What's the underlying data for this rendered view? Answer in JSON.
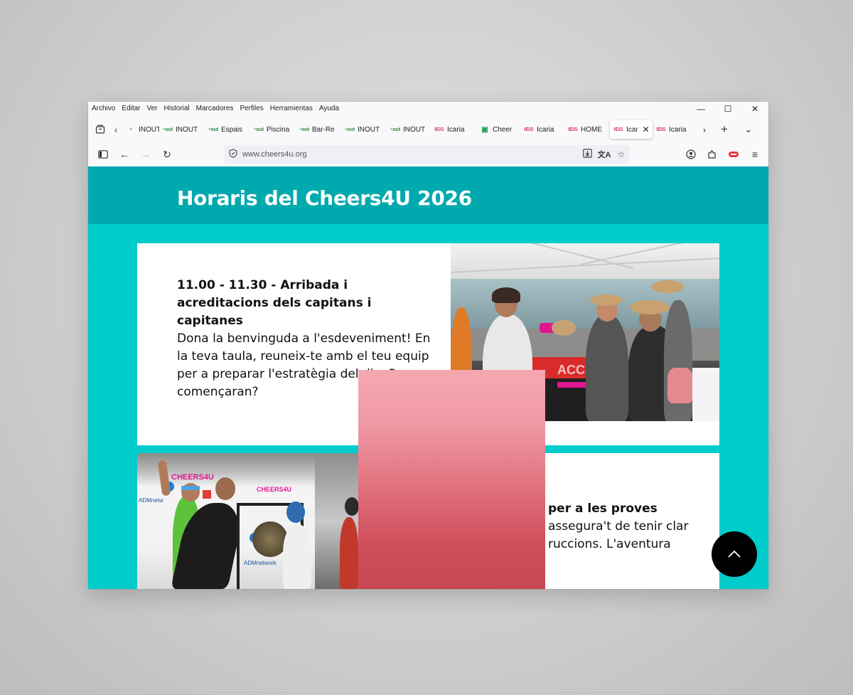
{
  "menubar": {
    "items": [
      "Archivo",
      "Editar",
      "Ver",
      "Historial",
      "Marcadores",
      "Perfiles",
      "Herramientas",
      "Ayuda"
    ]
  },
  "window_controls": {
    "minimize": "—",
    "maximize": "☐",
    "close": "✕"
  },
  "tabs": [
    {
      "label": "INOUT",
      "favicon": "inout"
    },
    {
      "label": "INOUT",
      "favicon": "inout"
    },
    {
      "label": "Espais",
      "favicon": "inout"
    },
    {
      "label": "Piscina",
      "favicon": "inout"
    },
    {
      "label": "Bar-Re",
      "favicon": "inout"
    },
    {
      "label": "INOUT",
      "favicon": "inout"
    },
    {
      "label": "INOUT",
      "favicon": "inout"
    },
    {
      "label": "Icaria",
      "favicon": "icaria"
    },
    {
      "label": "Cheer",
      "favicon": "cheer"
    },
    {
      "label": "Icaria",
      "favicon": "icaria"
    },
    {
      "label": "HOME",
      "favicon": "icaria"
    },
    {
      "label": "Icar",
      "favicon": "icaria",
      "active": true
    },
    {
      "label": "Icaria",
      "favicon": "icaria"
    }
  ],
  "navbar": {
    "url": "www.cheers4u.org"
  },
  "page": {
    "title": "Horaris del Cheers4U 2026",
    "card1": {
      "title": "11.00 - 11.30 - Arribada i acreditacions dels capitans i capitanes",
      "description": "Dona la benvinguda a l'esdeveniment! En la teva taula, reuneix-te amb el teu equip per a preparar l'estratègia del dia. Per on començaran?"
    },
    "card2": {
      "title_fragment": "per a les proves",
      "desc_line1": "assegura't de tenir clar",
      "desc_line2": "ruccions. L'aventura"
    },
    "photo1_banner": "ACCÉS",
    "photo2_logo": "CHEERS4U"
  },
  "colors": {
    "hero_bg": "#00a9ad",
    "content_bg": "#00cccc",
    "card_bg": "#ffffff",
    "overlay_top": "#f5a7b0",
    "overlay_bottom": "#c94654",
    "scroll_button": "#000000"
  },
  "icons": {
    "sidebar": "sidebar-icon",
    "back": "arrow-left-icon",
    "forward": "arrow-right-icon",
    "reload": "reload-icon",
    "shield": "shield-icon",
    "download": "download-icon",
    "translate": "translate-icon",
    "bookmark": "star-icon",
    "account": "account-icon",
    "extensions": "puzzle-icon",
    "menu": "hamburger-icon",
    "scroll_top": "chevron-up-icon"
  }
}
